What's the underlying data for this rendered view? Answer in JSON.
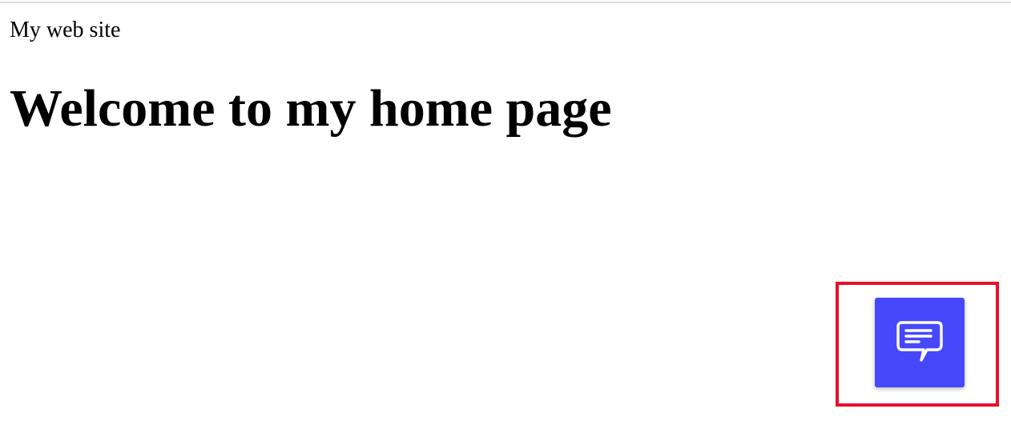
{
  "site": {
    "name": "My web site"
  },
  "main": {
    "heading": "Welcome to my home page"
  },
  "chat_widget": {
    "icon": "chat-bubble-icon",
    "button_color": "#4748fb",
    "highlight_color": "#e8102a"
  }
}
